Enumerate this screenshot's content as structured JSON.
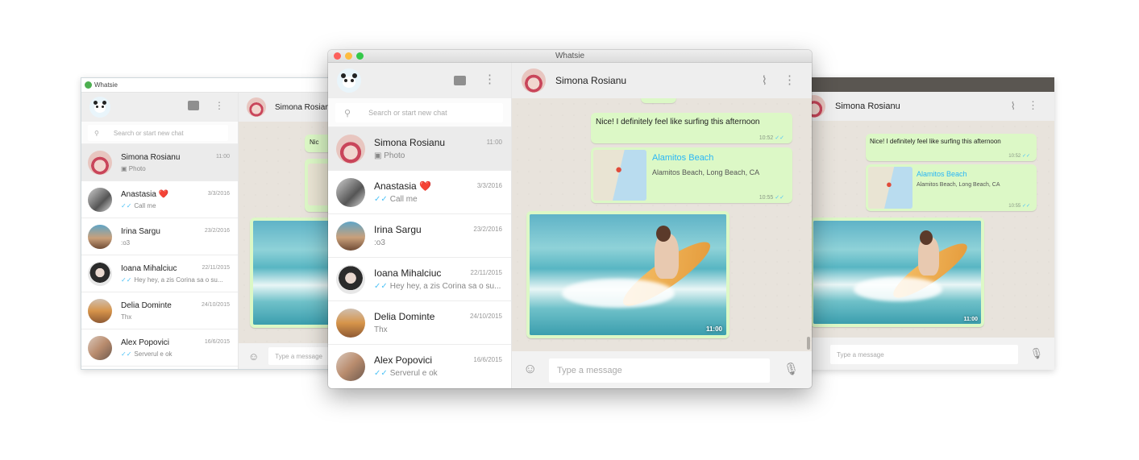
{
  "app": {
    "title": "Whatsie"
  },
  "sidebar": {
    "search_placeholder": "Search or start new chat",
    "chats": [
      {
        "name": "Simona Rosianu",
        "time": "11:00",
        "preview": "Photo",
        "preview_icon": "camera-icon",
        "active": true
      },
      {
        "name": "Anastasia ❤️",
        "time": "3/3/2016",
        "preview": "Call me",
        "ticks": true
      },
      {
        "name": "Irina Sargu",
        "time": "23/2/2016",
        "preview": ":o3"
      },
      {
        "name": "Ioana Mihalciuc",
        "time": "22/11/2015",
        "preview": "Hey hey, a zis Corina sa o su...",
        "ticks": true
      },
      {
        "name": "Delia Dominte",
        "time": "24/10/2015",
        "preview": "Thx"
      },
      {
        "name": "Alex Popovici",
        "time": "16/6/2015",
        "preview": "Serverul e ok",
        "ticks": true
      }
    ]
  },
  "chat": {
    "contact": "Simona Rosianu",
    "messages": [
      {
        "type": "text",
        "text": "Nice! I definitely feel like surfing this afternoon",
        "time": "10:52"
      },
      {
        "type": "location",
        "title": "Alamitos Beach",
        "address": "Alamitos Beach, Long Beach, CA",
        "time": "10:55"
      },
      {
        "type": "image",
        "time": "11:00"
      }
    ],
    "composer_placeholder": "Type a message"
  },
  "icons": {
    "new_chat": "chat-bubble-icon",
    "menu": "more-vert-icon",
    "attach": "paperclip-icon",
    "emoji": "smiley-icon",
    "mic": "microphone-icon",
    "search": "search-icon"
  },
  "colors": {
    "bubble": "#dcf8c6",
    "accent": "#4fc3f7",
    "header": "#eeeeee",
    "chat_bg": "#e8e3dc",
    "link": "#29b6f6"
  }
}
